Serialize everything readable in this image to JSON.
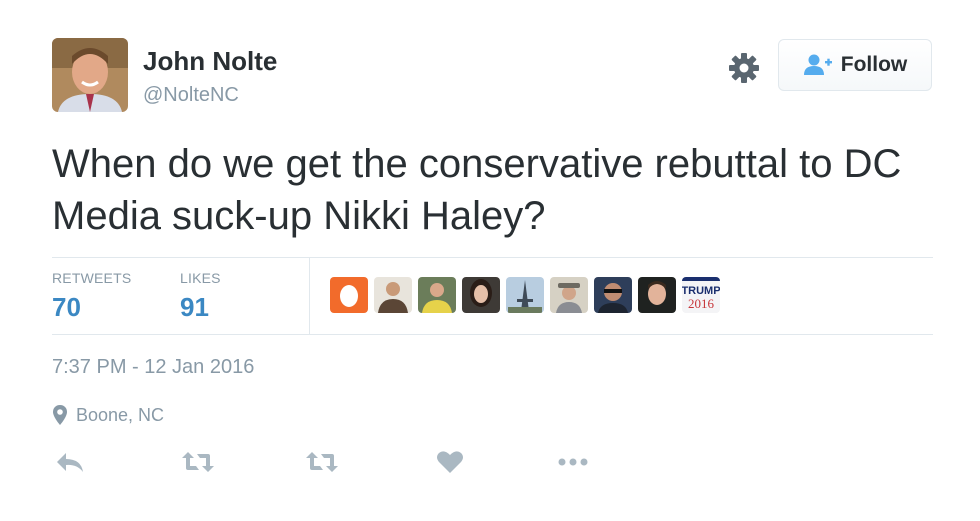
{
  "author": {
    "name": "John Nolte",
    "handle": "@NolteNC"
  },
  "header": {
    "settings_icon": "gear-icon",
    "follow_label": "Follow",
    "follow_icon": "add-user-icon"
  },
  "tweet": {
    "text": "When do we get the conservative rebuttal to DC Media suck-up Nikki Haley?"
  },
  "stats": {
    "retweets_label": "RETWEETS",
    "retweets_value": "70",
    "likes_label": "LIKES",
    "likes_value": "91"
  },
  "liker_avatars": [
    {
      "name": "orange-default-avatar"
    },
    {
      "name": "man-in-suit-avatar"
    },
    {
      "name": "man-yellow-shirt-avatar"
    },
    {
      "name": "woman-dark-hair-avatar"
    },
    {
      "name": "eiffel-tower-avatar"
    },
    {
      "name": "man-hat-avatar"
    },
    {
      "name": "man-sunglasses-avatar"
    },
    {
      "name": "young-man-avatar"
    },
    {
      "name": "trump-2016-avatar",
      "line1": "TRUMP",
      "line2": "2016"
    }
  ],
  "meta": {
    "timestamp": "7:37 PM - 12 Jan 2016",
    "location": "Boone, NC",
    "location_icon": "location-pin-icon"
  },
  "actions": [
    {
      "name": "reply-icon"
    },
    {
      "name": "retweet-icon"
    },
    {
      "name": "retweet-icon"
    },
    {
      "name": "heart-icon"
    },
    {
      "name": "more-icon"
    }
  ],
  "colors": {
    "text": "#292f33",
    "muted": "#8899a6",
    "link_blue": "#3b88c3",
    "follow_icon_blue": "#55acee",
    "border": "#e1e8ed"
  }
}
